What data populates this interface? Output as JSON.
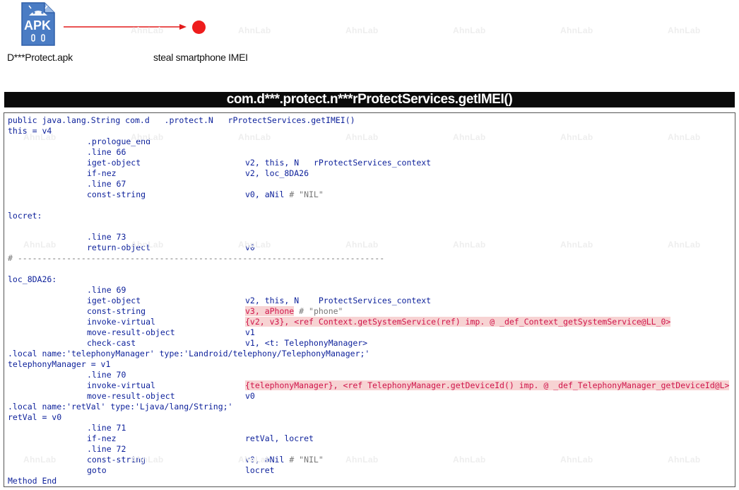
{
  "header": {
    "apk_icon_text": "APK",
    "apk_file_name": "D***Protect.apk",
    "target_label": "steal smartphone IMEI",
    "arrow_color": "#e31b1b",
    "dot_color": "#ee1c1c"
  },
  "title": "com.d***.protect.n***rProtectServices.getIMEI()",
  "watermark": "AhnLab",
  "code": [
    {
      "a": "public java.lang.String com.d   .protect.N   rProtectServices.getIMEI()"
    },
    {
      "a": "this = v4"
    },
    {
      "b": ".prologue_end"
    },
    {
      "b": ".line 66"
    },
    {
      "b": "iget-object",
      "c": "v2, this, N   rProtectServices_context"
    },
    {
      "b": "if-nez",
      "c": "v2, loc_8DA26"
    },
    {
      "b": ".line 67"
    },
    {
      "b": "const-string",
      "c": "v0, aNil",
      "c_comment": " # \"NIL\""
    },
    {},
    {
      "a": "locret:"
    },
    {},
    {
      "b": ".line 73"
    },
    {
      "b": "return-object",
      "c": "v0"
    },
    {
      "a": "# ---------------------------------------------------------------------------"
    },
    {},
    {
      "a": "loc_8DA26:"
    },
    {
      "b": ".line 69"
    },
    {
      "b": "iget-object",
      "c": "v2, this, N    ProtectServices_context"
    },
    {
      "b": "const-string",
      "c_hl": "v3, aPhone",
      "c_comment": " # \"phone\""
    },
    {
      "b": "invoke-virtual",
      "c_hl": "{v2, v3}, <ref Context.getSystemService(ref) imp. @ _def_Context_getSystemService@LL_0>"
    },
    {
      "b": "move-result-object",
      "c": "v1"
    },
    {
      "b": "check-cast",
      "c": "v1, <t: TelephonyManager>"
    },
    {
      "a": ".local name:'telephonyManager' type:'Landroid/telephony/TelephonyManager;'"
    },
    {
      "a": "telephonyManager = v1"
    },
    {
      "b": ".line 70"
    },
    {
      "b": "invoke-virtual",
      "c_hl": "{telephonyManager}, <ref TelephonyManager.getDeviceId() imp. @ _def_TelephonyManager_getDeviceId@L>"
    },
    {
      "b": "move-result-object",
      "c": "v0"
    },
    {
      "a": ".local name:'retVal' type:'Ljava/lang/String;'"
    },
    {
      "a": "retVal = v0"
    },
    {
      "b": ".line 71"
    },
    {
      "b": "if-nez",
      "c": "retVal, locret"
    },
    {
      "b": ".line 72"
    },
    {
      "b": "const-string",
      "c": "v0, aNil",
      "c_comment": " # \"NIL\""
    },
    {
      "b": "goto",
      "c": "locret"
    },
    {
      "a": "Method End"
    }
  ]
}
